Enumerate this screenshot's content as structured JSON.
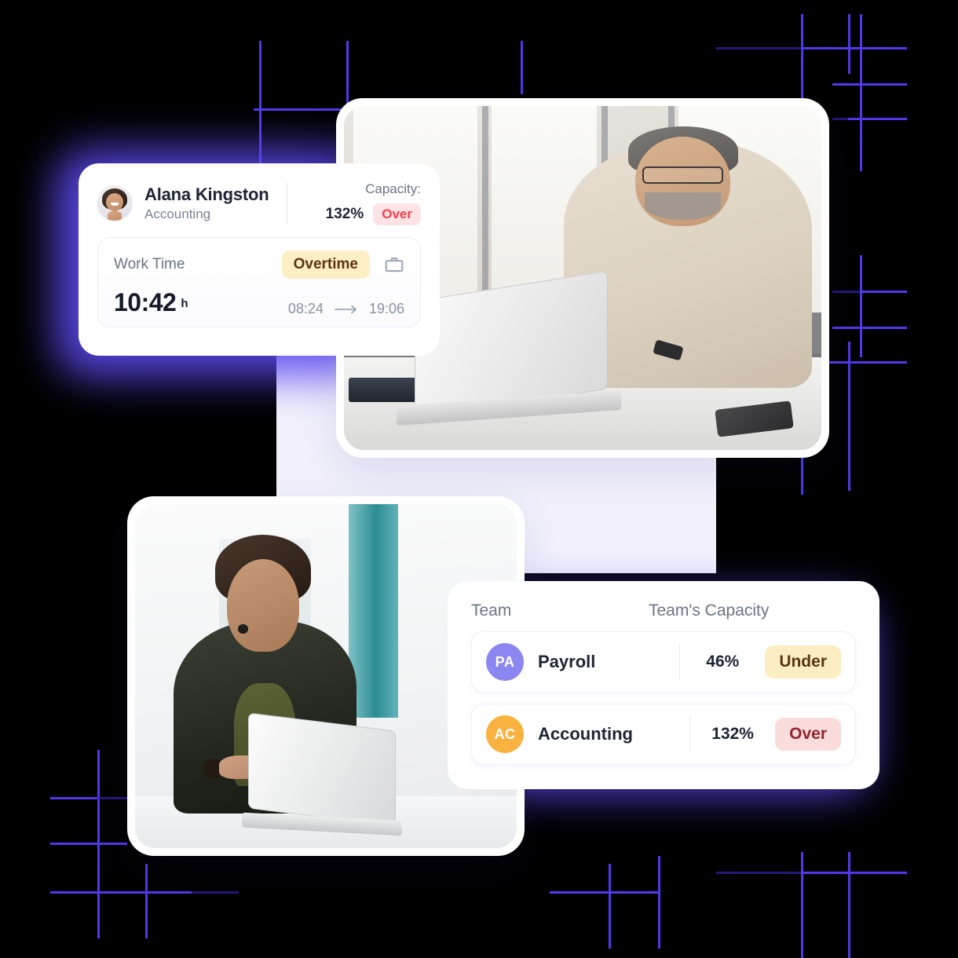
{
  "employee_card": {
    "name": "Alana Kingston",
    "department": "Accounting",
    "avatar_name": "alana-avatar",
    "capacity_label": "Capacity:",
    "capacity_percent": "132%",
    "capacity_badge": "Over",
    "capacity_badge_bg": "#FDE3E5",
    "capacity_badge_fg": "#F43F4E",
    "work_time": {
      "label": "Work Time",
      "status_badge": "Overtime",
      "status_badge_bg": "#FDEEC6",
      "status_badge_fg": "#5B3413",
      "icon": "briefcase-icon",
      "hours": "10:42",
      "unit": "h",
      "start": "08:24",
      "end": "19:06",
      "range_icon": "arrow-right-icon"
    }
  },
  "team_card": {
    "col_team": "Team",
    "col_capacity": "Team's Capacity",
    "rows": [
      {
        "initials": "PA",
        "avatar_color": "#8B86F0",
        "name": "Payroll",
        "percent": "46%",
        "badge": "Under",
        "badge_bg": "#FBEEC2",
        "badge_fg": "#5B3413"
      },
      {
        "initials": "AC",
        "avatar_color": "#F9B23F",
        "name": "Accounting",
        "percent": "132%",
        "badge": "Over",
        "badge_bg": "#FBDCDD",
        "badge_fg": "#93262D"
      }
    ]
  },
  "photos": [
    {
      "name": "photo-man-at-laptop",
      "alt": "Smiling man with glasses working at a laptop in an office"
    },
    {
      "name": "photo-woman-at-laptop",
      "alt": "Smiling woman in a dark blazer typing on a laptop"
    }
  ],
  "theme": {
    "background": "#000000",
    "grid_line": "#4F39E8",
    "glow": "#5B4AF0",
    "card_bg": "#FFFFFF",
    "text_primary": "#1D2433",
    "text_muted": "#6B7585"
  }
}
